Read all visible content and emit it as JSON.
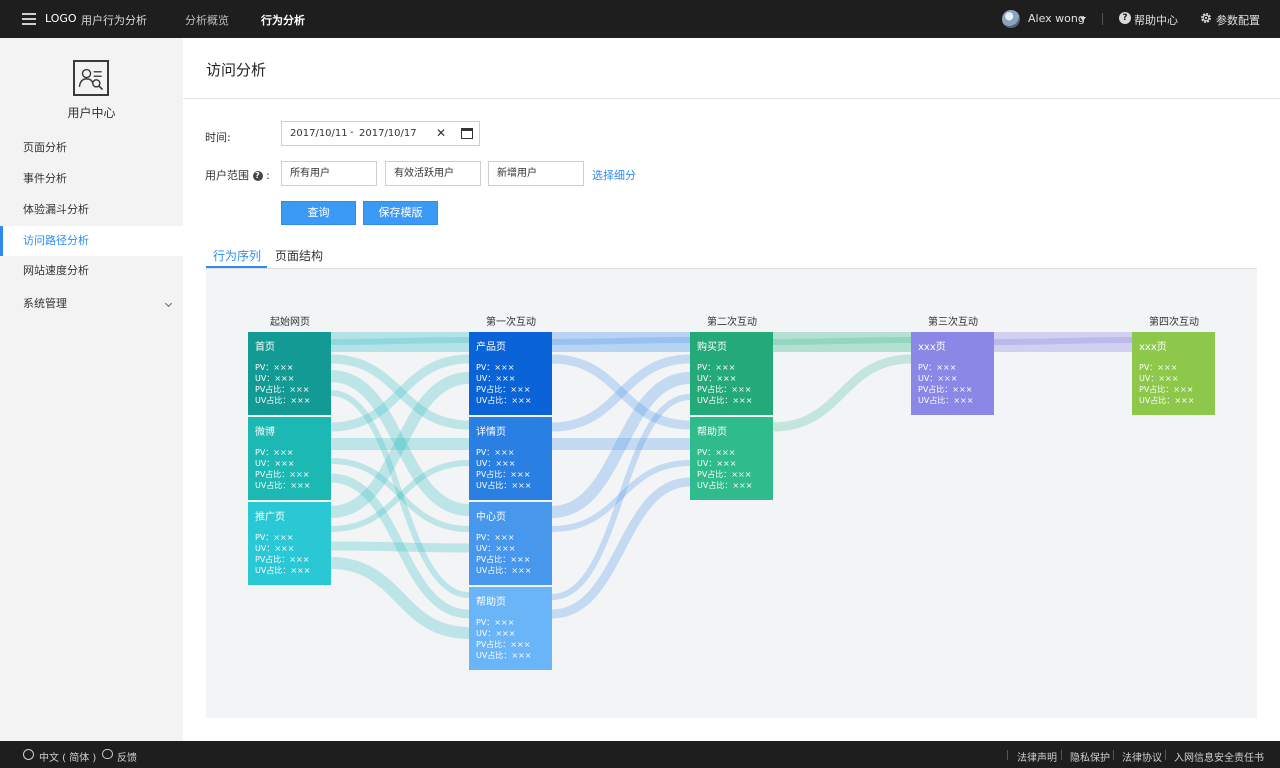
{
  "header": {
    "logo": "LOGO",
    "app_title": "用户行为分析",
    "nav": [
      "分析概览",
      "行为分析"
    ],
    "user_name": "Alex wong",
    "help": "帮助中心",
    "settings": "参数配置"
  },
  "sidebar": {
    "title": "用户中心",
    "items": [
      {
        "label": "页面分析"
      },
      {
        "label": "事件分析"
      },
      {
        "label": "体验漏斗分析"
      },
      {
        "label": "访问路径分析",
        "active": true
      },
      {
        "label": "网站速度分析"
      },
      {
        "label": "系统管理"
      }
    ]
  },
  "main": {
    "title": "访问分析",
    "time_label": "时间:",
    "date_start": "2017/10/11",
    "date_sep": "-",
    "date_end": "2017/10/17",
    "clear_glyph": "✕",
    "user_range_label": "用户范围",
    "user_range_suffix": ":",
    "user_options": [
      "所有用户",
      "有效活跃用户",
      "新增用户"
    ],
    "choose_link": "选择细分",
    "query_button": "查询",
    "save_button": "保存模版",
    "tabs": [
      "行为序列",
      "页面结构"
    ]
  },
  "flow": {
    "columns": [
      "起始网页",
      "第一次互动",
      "第二次互动",
      "第三次互动",
      "第四次互动"
    ],
    "nodes": [
      {
        "title": "首页",
        "color": "#139a94"
      },
      {
        "title": "微博",
        "color": "#1bb8b4"
      },
      {
        "title": "推广页",
        "color": "#2ac8d4"
      },
      {
        "title": "产品页",
        "color": "#0a64d8"
      },
      {
        "title": "详情页",
        "color": "#2a7fe2"
      },
      {
        "title": "中心页",
        "color": "#4797ec"
      },
      {
        "title": "帮助页",
        "color": "#6ab4f8"
      },
      {
        "title": "购买页",
        "color": "#24a978"
      },
      {
        "title": "帮助页",
        "color": "#2fbb8c"
      },
      {
        "title": "xxx页",
        "color": "#8a87e6"
      },
      {
        "title": "xxx页",
        "color": "#8dc84a"
      }
    ],
    "stats": [
      "PV：×××",
      "UV：×××",
      "PV占比：×××",
      "UV占比：×××"
    ]
  },
  "footer": {
    "lang": "中文 ( 简体 )",
    "feedback": "反馈",
    "links": [
      "法律声明",
      "隐私保护",
      "法律协议",
      "入网信息安全责任书"
    ]
  }
}
